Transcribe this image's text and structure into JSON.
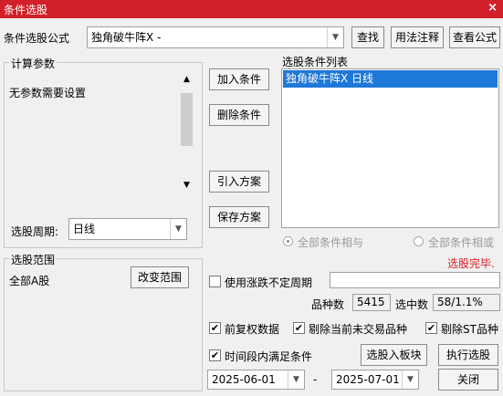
{
  "window": {
    "title": "条件选股",
    "close_glyph": "×"
  },
  "formula": {
    "label": "条件选股公式",
    "value": "独角破牛阵X  -",
    "find_button": "查找",
    "usage_button": "用法注释",
    "view_button": "查看公式"
  },
  "params": {
    "title": "计算参数",
    "text": "无参数需要设置",
    "period_label": "选股周期:",
    "period_value": "日线"
  },
  "middle": {
    "add_button": "加入条件",
    "delete_button": "删除条件",
    "import_button": "引入方案",
    "save_button": "保存方案"
  },
  "conditions": {
    "title": "选股条件列表",
    "items": [
      "独角破牛阵X  日线"
    ],
    "radio_and": "全部条件相与",
    "radio_or": "全部条件相或",
    "status": "选股完毕."
  },
  "range": {
    "title": "选股范围",
    "value": "全部A股",
    "change_button": "改变范围"
  },
  "options": {
    "uncertain_period": "使用涨跌不定周期",
    "count_label": "品种数",
    "count_value": "5415",
    "selected_label": "选中数",
    "selected_value": "58/1.1%",
    "forward_adjust": "前复权数据",
    "exclude_untraded": "剔除当前未交易品种",
    "exclude_st": "剔除ST品种",
    "time_condition": "时间段内满足条件",
    "check_glyph": "✔"
  },
  "actions": {
    "to_block_button": "选股入板块",
    "run_button": "执行选股",
    "close_button": "关闭",
    "date_from": "2025-06-01",
    "date_sep": "-",
    "date_to": "2025-07-01"
  },
  "colors": {
    "title_bar": "#d2202a",
    "selection": "#1e78d7",
    "status": "#e02020"
  }
}
